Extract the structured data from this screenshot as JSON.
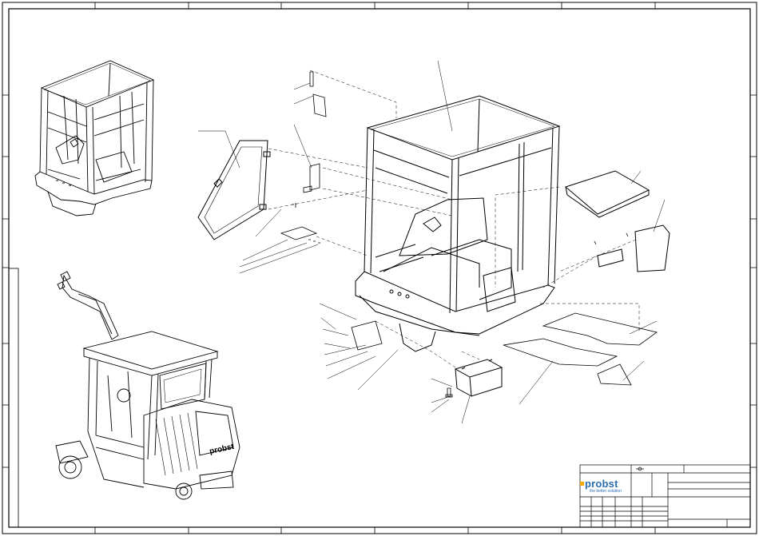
{
  "drawing": {
    "type": "exploded-assembly-drawing",
    "subject": "cab assembly"
  },
  "title_block": {
    "company_logo": "probst",
    "slogan": "the better solution",
    "accent_color": "#2a6db0",
    "logo_mark_color": "#f2a900"
  },
  "machine_label": "probst"
}
